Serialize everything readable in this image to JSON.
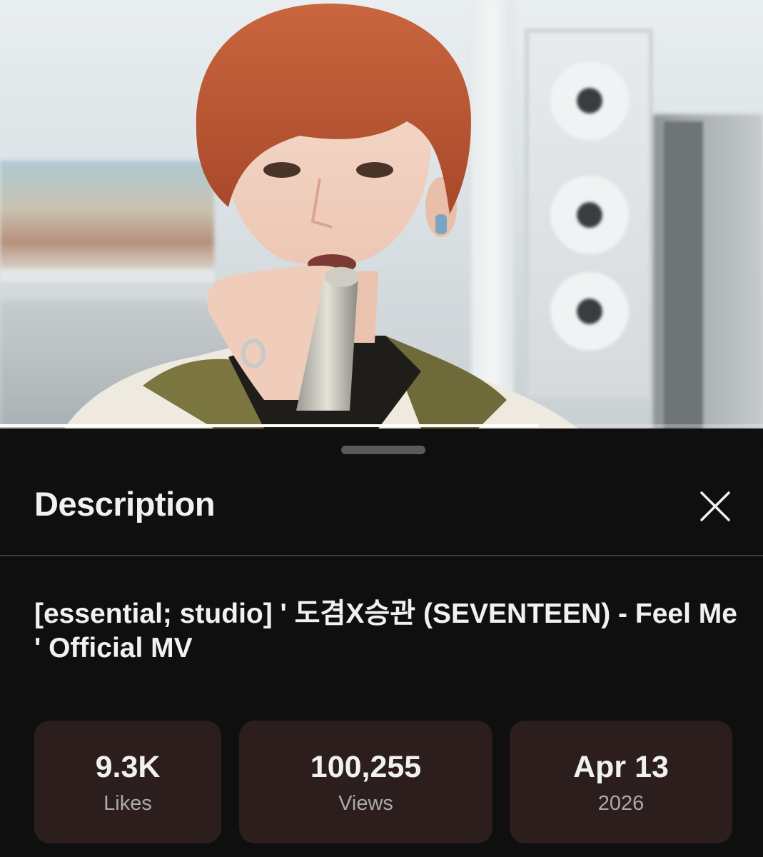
{
  "player": {
    "progress_fraction": 0.705
  },
  "description_panel": {
    "title": "Description",
    "close_icon": "close-icon",
    "video_title": "[essential; studio] ' 도겸X승관 (SEVENTEEN) - Feel Me ' Official MV",
    "stats": [
      {
        "value": "9.3K",
        "label": "Likes"
      },
      {
        "value": "100,255",
        "label": "Views"
      },
      {
        "value": "Apr 13",
        "label": "2026"
      }
    ]
  },
  "colors": {
    "background": "#0f0f0f",
    "stat_card": "#2b1e1c",
    "primary_text": "#f1f1f1",
    "secondary_text": "#aaaaaa"
  }
}
